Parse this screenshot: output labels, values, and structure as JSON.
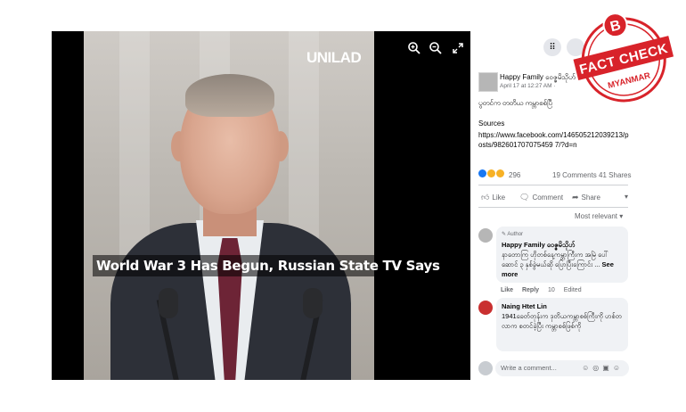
{
  "video": {
    "watermark": "UNILAD",
    "caption": "World War 3 Has Begun, Russian State TV Says",
    "controls": [
      "zoom-in-icon",
      "zoom-out-icon",
      "fullscreen-icon"
    ]
  },
  "post": {
    "author": "Happy Family ဝေဇ္ဇမိသိုဟ်",
    "time": "April 17 at 12:27 AM · ",
    "text": "ပွတင်က တတိယ ကမ္ဘာစစ်ပြီ",
    "sources_label": "Sources",
    "source_link": "https://www.facebook.com/146505212039213/posts/982601707075459 7/?d=n",
    "reaction_count": "296",
    "comments": "19 Comments",
    "shares": "41 Shares"
  },
  "actions": {
    "like": "Like",
    "comment": "Comment",
    "share": "Share"
  },
  "sort_label": "Most relevant",
  "comments": [
    {
      "tag": "Author",
      "name": "Happy Family ဝေဇ္ဇမိသိုဟ်",
      "text": "နာတောကြ ဟိုတစ်နေ့ကမ္ဘာကြီးက အမြဲ ပေါ်ဆောင် ၃ နှစ်ခွဲမယ်ဆို ပြောပြီးကြောင်း ...",
      "see_more": "See more",
      "like": "Like",
      "reply": "Reply",
      "age": "10",
      "edited": "Edited"
    },
    {
      "name": "Naing Htet Lin",
      "text": "1941ခေတ်တုန်းက ဒုတိယကမ္ဘာစစ်ကြီးကို ဟစ်တလာက စတင်ခဲ့ပြီး ကမ္ဘာစစ်ဖြစ်ကို"
    }
  ],
  "write_placeholder": "Write a comment...",
  "badge": {
    "letter": "B",
    "line1": "FACT CHECK",
    "line2": "MYANMAR"
  },
  "colors": {
    "badge_red": "#d8232a",
    "link_blue": "#1877f2"
  }
}
